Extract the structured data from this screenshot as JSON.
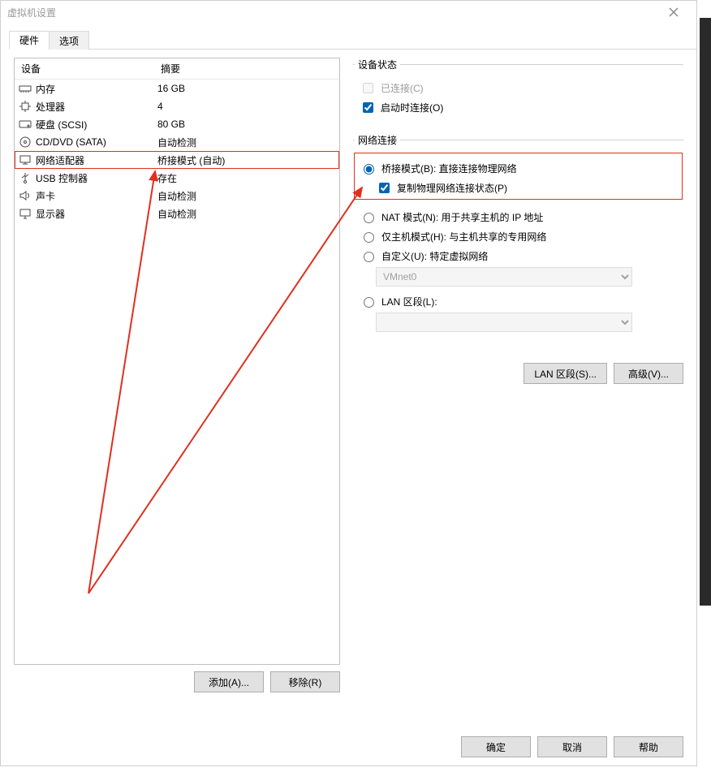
{
  "window": {
    "title": "虚拟机设置"
  },
  "tabs": {
    "hardware": "硬件",
    "options": "选项"
  },
  "device_list": {
    "header_device": "设备",
    "header_summary": "摘要",
    "items": [
      {
        "icon": "memory",
        "name": "内存",
        "summary": "16 GB"
      },
      {
        "icon": "cpu",
        "name": "处理器",
        "summary": "4"
      },
      {
        "icon": "disk",
        "name": "硬盘 (SCSI)",
        "summary": "80 GB"
      },
      {
        "icon": "cd",
        "name": "CD/DVD (SATA)",
        "summary": "自动检测"
      },
      {
        "icon": "network",
        "name": "网络适配器",
        "summary": "桥接模式 (自动)",
        "highlight": true
      },
      {
        "icon": "usb",
        "name": "USB 控制器",
        "summary": "存在"
      },
      {
        "icon": "sound",
        "name": "声卡",
        "summary": "自动检测"
      },
      {
        "icon": "display",
        "name": "显示器",
        "summary": "自动检测"
      }
    ]
  },
  "left_buttons": {
    "add": "添加(A)...",
    "remove": "移除(R)"
  },
  "device_status": {
    "legend": "设备状态",
    "connected_label": "已连接(C)",
    "connect_at_power_label": "启动时连接(O)"
  },
  "network": {
    "legend": "网络连接",
    "bridged": "桥接模式(B): 直接连接物理网络",
    "replicate": "复制物理网络连接状态(P)",
    "nat": "NAT 模式(N): 用于共享主机的 IP 地址",
    "hostonly": "仅主机模式(H): 与主机共享的专用网络",
    "custom": "自定义(U): 特定虚拟网络",
    "custom_value": "VMnet0",
    "lan_segment": "LAN 区段(L):",
    "lan_segment_value": ""
  },
  "right_buttons": {
    "lan": "LAN 区段(S)...",
    "advanced": "高级(V)..."
  },
  "bottom": {
    "ok": "确定",
    "cancel": "取消",
    "help": "帮助"
  }
}
